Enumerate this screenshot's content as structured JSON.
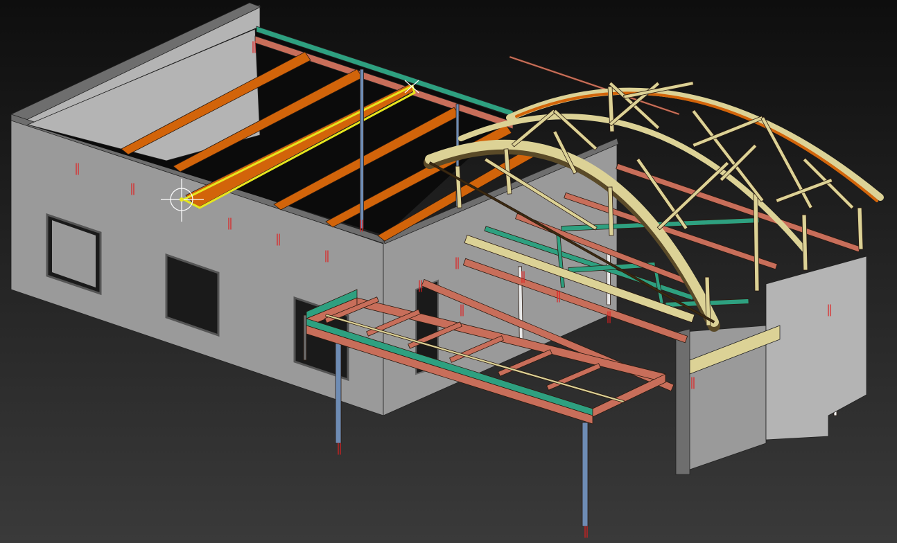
{
  "viewport": {
    "background_top": "#0e0e0e",
    "background_bottom": "#3a3a3a",
    "selection_color": "#e6e61e"
  },
  "materials": {
    "wall": "#9a9a9a",
    "wall_light": "#b4b4b4",
    "wall_dark": "#6e6e6e",
    "steel_beam": "#c86e5a",
    "roof_purlin": "#d2640a",
    "timber": "#dcd296",
    "bracing": "#2ea080",
    "column": "#6e8cb4"
  },
  "model": {
    "elements": [
      "main-building-walls",
      "roof-purlins",
      "selected-purlin",
      "curved-timber-roof-truss",
      "steel-canopy-frame",
      "steel-columns",
      "bracing-members",
      "side-wall-block",
      "window-openings"
    ]
  }
}
